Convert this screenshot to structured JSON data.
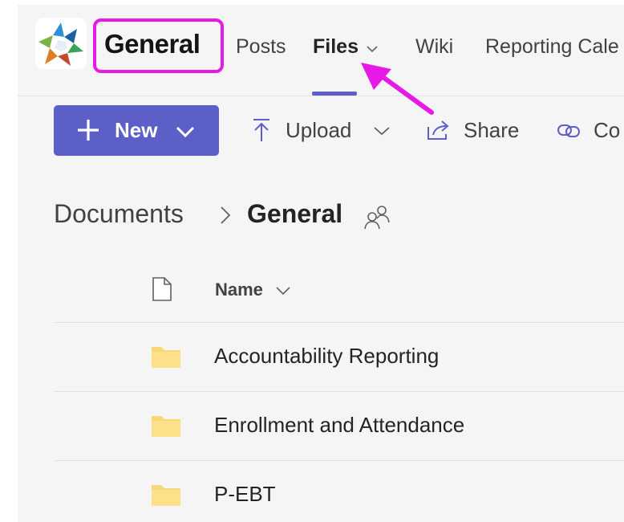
{
  "header": {
    "channel_name": "General",
    "tabs": [
      {
        "label": "Posts"
      },
      {
        "label": "Files"
      },
      {
        "label": "Wiki"
      },
      {
        "label": "Reporting Cale"
      }
    ],
    "highlight_color": "#e619e6"
  },
  "toolbar": {
    "new_label": "New",
    "upload_label": "Upload",
    "share_label": "Share",
    "copy_label": "Co"
  },
  "breadcrumb": {
    "root": "Documents",
    "current": "General"
  },
  "list": {
    "name_header": "Name",
    "folders": [
      {
        "name": "Accountability Reporting"
      },
      {
        "name": "Enrollment and Attendance"
      },
      {
        "name": "P-EBT"
      }
    ]
  },
  "colors": {
    "accent": "#5b5fc7",
    "folder": "#f8d775",
    "annotation": "#e619e6"
  },
  "icons": [
    "team-logo-icon",
    "chevron-down-icon",
    "plus-icon",
    "upload-icon",
    "share-icon",
    "copy-link-icon",
    "chevron-right-icon",
    "people-icon",
    "document-icon",
    "folder-icon"
  ]
}
